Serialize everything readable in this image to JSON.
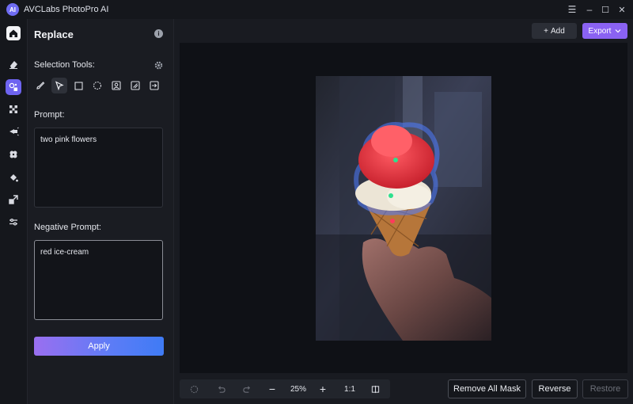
{
  "app": {
    "title": "AVCLabs PhotoPro AI",
    "logo_text": "AI"
  },
  "window_controls": {
    "menu": "☰",
    "minimize": "–",
    "maximize": "☐",
    "close": "✕"
  },
  "rail": [
    "home-icon",
    "eraser-icon",
    "replace-icon",
    "expand-icon",
    "lamp-icon",
    "flower-icon",
    "fill-icon",
    "resize-icon",
    "sliders-icon"
  ],
  "panel": {
    "title": "Replace",
    "selection_tools_label": "Selection Tools:",
    "prompt_label": "Prompt:",
    "prompt_value": "two pink flowers",
    "negative_prompt_label": "Negative Prompt:",
    "negative_prompt_value": "red ice-cream",
    "apply_label": "Apply"
  },
  "tools": [
    "brush-icon",
    "pointer-icon",
    "rect-select-icon",
    "ellipse-select-icon",
    "portrait-select-icon",
    "object-select-icon",
    "import-icon"
  ],
  "topbar": {
    "add_label": "Add",
    "export_label": "Export"
  },
  "bottom": {
    "zoom": "25%",
    "ratio": "1:1",
    "remove_all_mask": "Remove All Mask",
    "reverse": "Reverse",
    "restore": "Restore"
  },
  "colors": {
    "accent": "#6e64f0",
    "export": "#8a62f2",
    "background": "#15171c",
    "mask_outline": "#4f7cff"
  }
}
